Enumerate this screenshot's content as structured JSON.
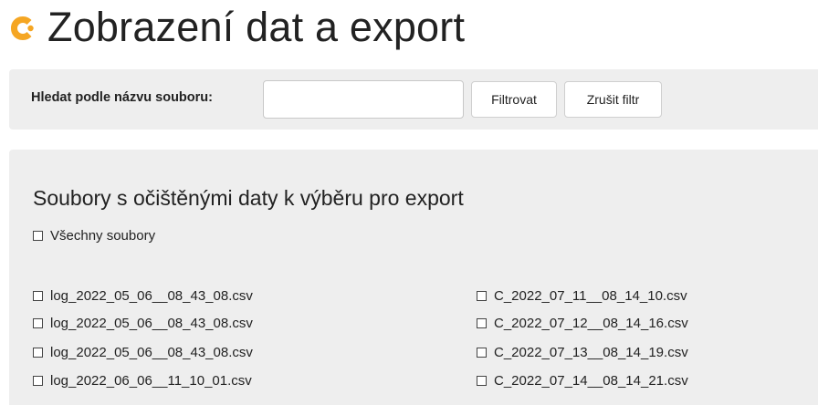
{
  "header": {
    "title": "Zobrazení dat a export",
    "logo_icon": "orange-c-logo-icon",
    "logo_color": "#f5a623"
  },
  "filter": {
    "label": "Hledat podle názvu souboru:",
    "input_value": "",
    "filter_button": "Filtrovat",
    "clear_button": "Zrušit filtr"
  },
  "files": {
    "heading": "Soubory s očištěnými daty k výběru pro export",
    "all_label": "Všechny soubory",
    "left_column": [
      "log_2022_05_06__08_43_08.csv",
      "log_2022_05_06__08_43_08.csv",
      "log_2022_05_06__08_43_08.csv",
      "log_2022_06_06__11_10_01.csv"
    ],
    "right_column": [
      "C_2022_07_11__08_14_10.csv",
      "C_2022_07_12__08_14_16.csv",
      "C_2022_07_13__08_14_19.csv",
      "C_2022_07_14__08_14_21.csv"
    ]
  }
}
